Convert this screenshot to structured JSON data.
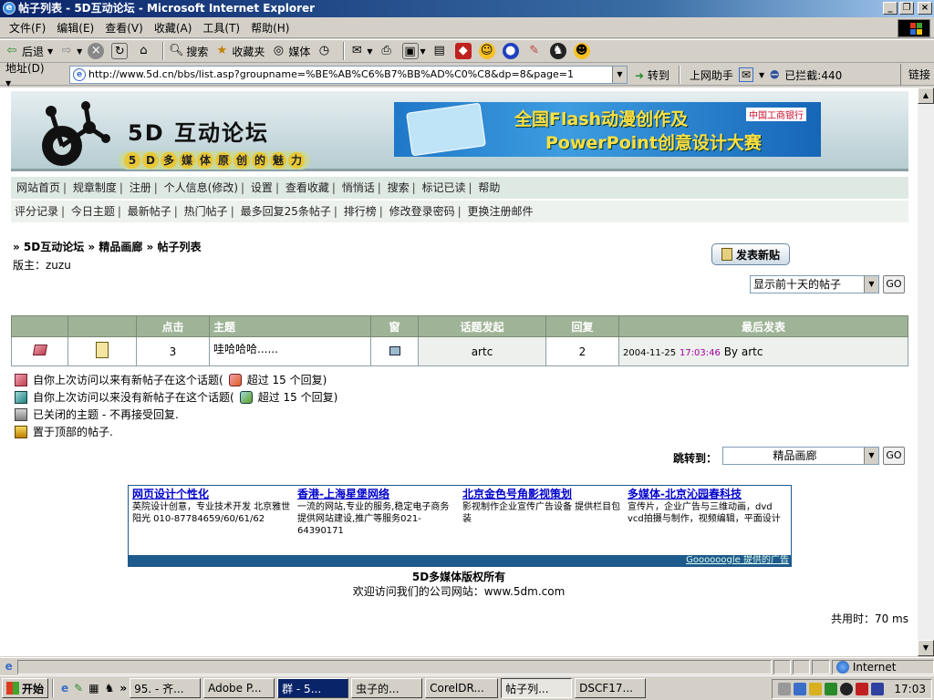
{
  "window": {
    "title": "帖子列表 - 5D互动论坛 - Microsoft Internet Explorer"
  },
  "menu": [
    "文件(F)",
    "编辑(E)",
    "查看(V)",
    "收藏(A)",
    "工具(T)",
    "帮助(H)"
  ],
  "toolbar": {
    "back": "后退",
    "search": "搜索",
    "favorites": "收藏夹",
    "media": "媒体"
  },
  "address": {
    "label": "地址(D)",
    "url": "http://www.5d.cn/bbs/list.asp?groupname=%BE%AB%C6%B7%BB%AD%C0%C8&dp=8&page=1",
    "go": "转到",
    "helper": "上网助手",
    "blocked": "已拦截:440",
    "links": "链接"
  },
  "site": {
    "name": "5D 互动论坛",
    "slogan_chars": [
      "5",
      "D",
      "多",
      "媒",
      "体",
      "原",
      "创",
      "的",
      "魅",
      "力"
    ],
    "ad_line1": "全国Flash动漫创作及",
    "ad_line2": "PowerPoint创意设计大赛",
    "ad_bank": "中国工商银行"
  },
  "nav1": [
    "网站首页",
    "规章制度",
    "注册",
    "个人信息(修改)",
    "设置",
    "查看收藏",
    "悄悄话",
    "搜索",
    "标记已读",
    "帮助"
  ],
  "nav2": [
    "评分记录",
    "今日主题",
    "最新帖子",
    "热门帖子",
    "最多回复25条帖子",
    "排行榜",
    "修改登录密码",
    "更换注册邮件"
  ],
  "breadcrumb": "» 5D互动论坛 » 精品画廊 » 帖子列表",
  "moderator": "版主：zuzu",
  "new_post": "发表新贴",
  "filter": {
    "selected": "显示前十天的帖子",
    "go": "GO"
  },
  "table": {
    "headers": [
      "",
      "",
      "点击",
      "主题",
      "窗",
      "话题发起",
      "回复",
      "最后发表"
    ],
    "rows": [
      {
        "clicks": "3",
        "title": "哇哈哈哈......",
        "author": "artc",
        "replies": "2",
        "last_date": "2004-11-25",
        "last_time": "17:03:46",
        "last_by": "By artc"
      }
    ]
  },
  "legend": [
    "自你上次访问以来有新帖子在这个话题(",
    "超过 15 个回复)",
    "自你上次访问以来没有新帖子在这个话题(",
    "超过 15 个回复)",
    "已关闭的主题 - 不再接受回复.",
    "置于顶部的帖子."
  ],
  "jump": {
    "label": "跳转到：",
    "selected": "精品画廊",
    "go": "GO"
  },
  "ads": [
    {
      "title": "网页设计个性化",
      "text": "英院设计创意，专业技术开发 北京雅世阳光 010-87784659/60/61/62"
    },
    {
      "title": "香港-上海星堡网络",
      "text": "一流的网站,专业的服务,稳定电子商务 提供网站建设,推广等服务021-64390171"
    },
    {
      "title": "北京金色号角影视策划",
      "text": "影视制作企业宣传广告设备 提供栏目包装"
    },
    {
      "title": "多媒体-北京沁园春科技",
      "text": "宣传片，企业广告与三维动画，dvd vcd拍摄与制作，视频编辑，平面设计"
    }
  ],
  "ad_footer": "Goooooogle 提供的广告",
  "copyright": "5D多媒体版权所有",
  "company": "欢迎访问我们的公司网站：www.5dm.com",
  "timing": "共用时：70 ms",
  "status": {
    "zone": "Internet"
  },
  "taskbar": {
    "start": "开始",
    "tasks": [
      "95. - 齐...",
      "Adobe P...",
      "群 - 5...",
      "虫子的...",
      "CorelDR...",
      "帖子列...",
      "DSCF17..."
    ],
    "time": "17:03"
  }
}
